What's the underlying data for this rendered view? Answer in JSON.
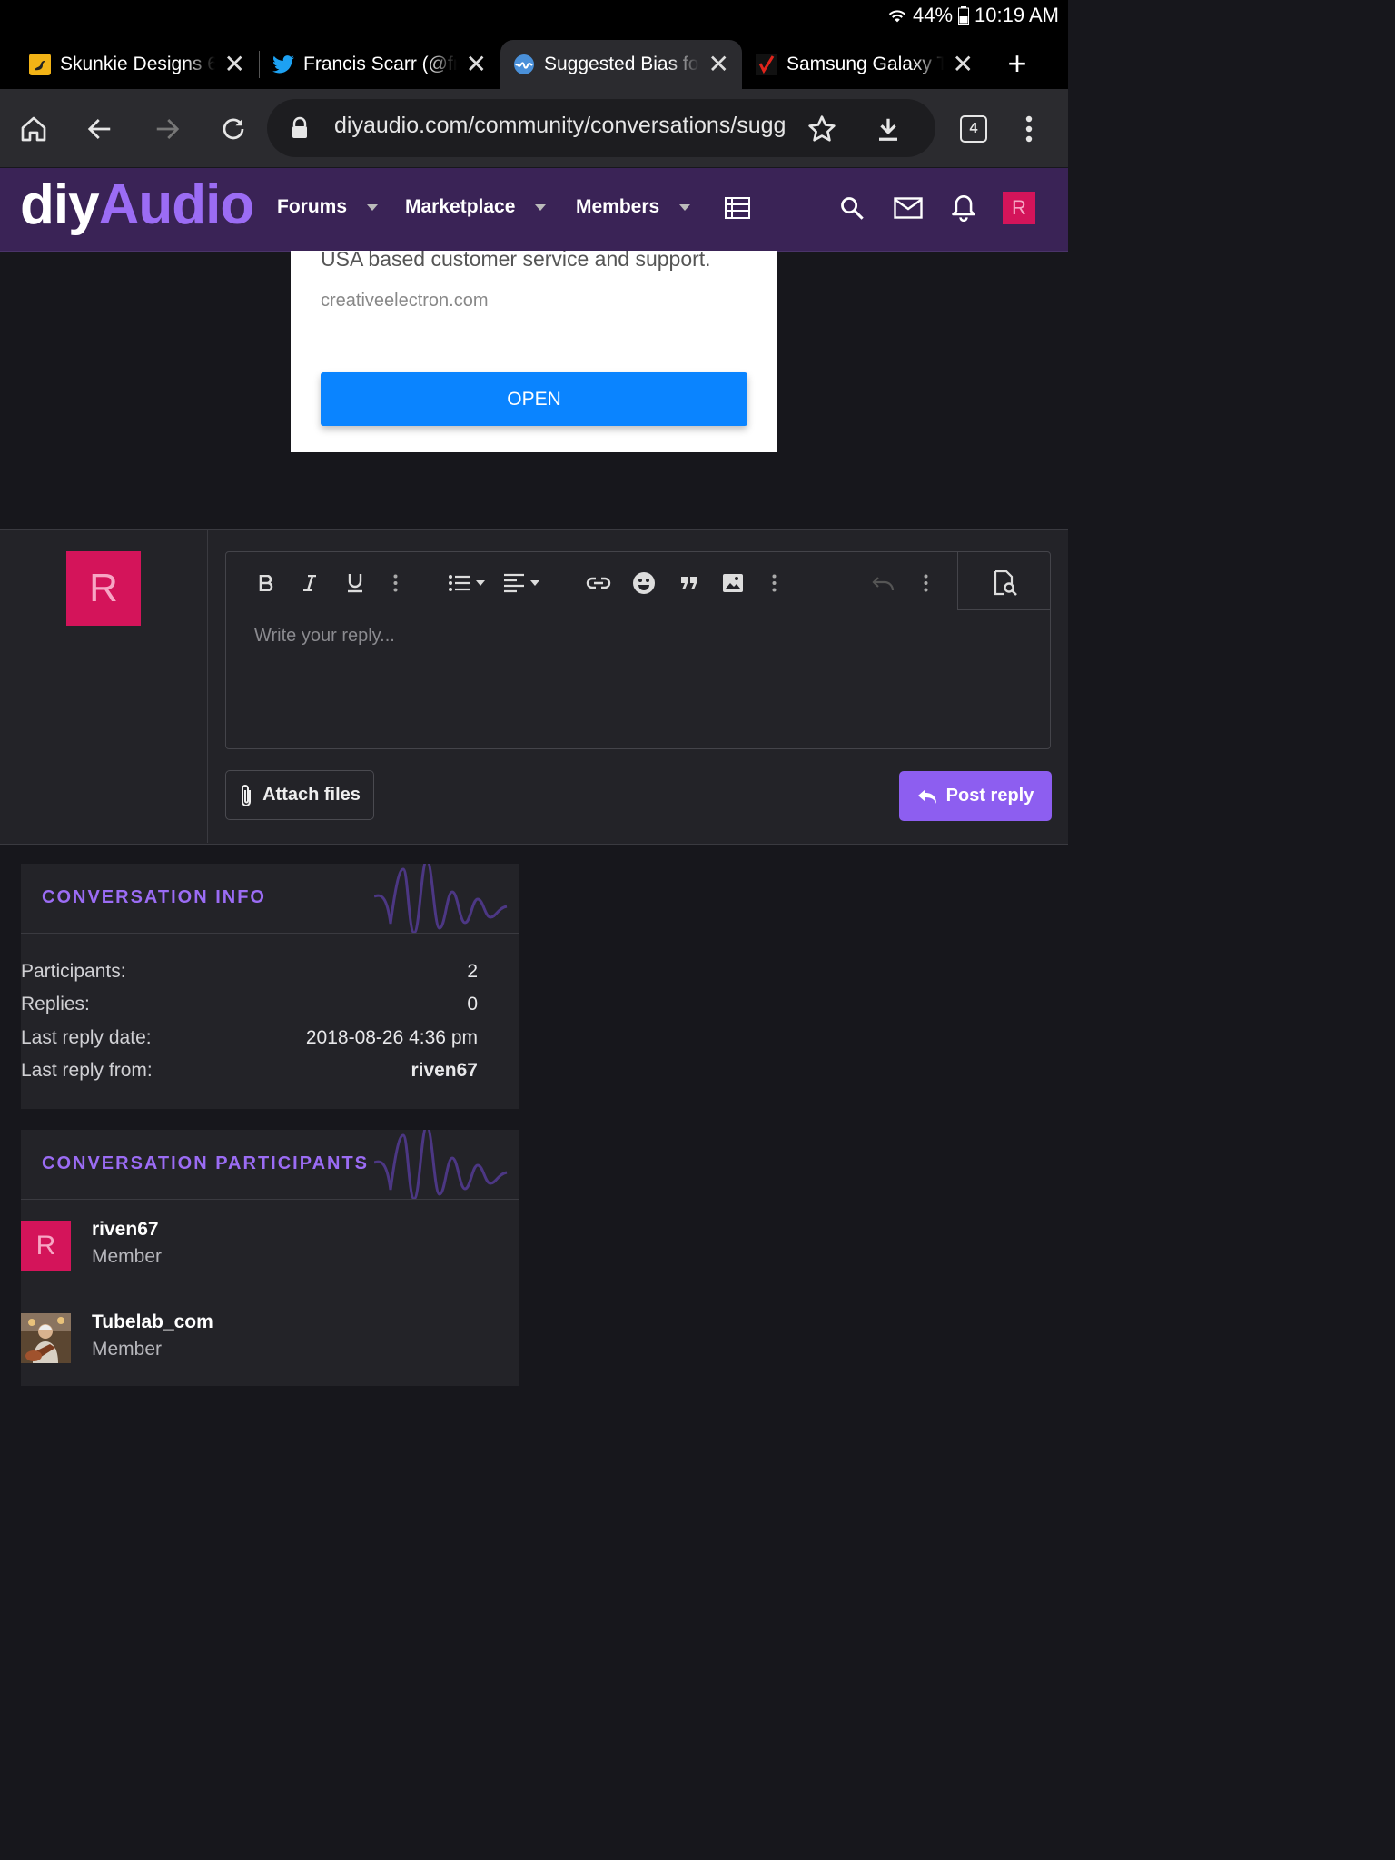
{
  "status_bar": {
    "battery": "44%",
    "time": "10:19 AM"
  },
  "tabs": [
    {
      "title": "Skunkie Designs 6",
      "close": "✕"
    },
    {
      "title": "Francis Scarr (@fr",
      "close": "✕"
    },
    {
      "title": "Suggested Bias fo",
      "close": "✕"
    },
    {
      "title": "Samsung Galaxy T",
      "close": "✕"
    }
  ],
  "new_tab": "+",
  "toolbar": {
    "url": "diyaudio.com/community/conversations/sugg",
    "tab_count": "4"
  },
  "site": {
    "logo_a": "diy",
    "logo_b": "Audio",
    "nav": [
      "Forums",
      "Marketplace",
      "Members"
    ],
    "user_initial": "R"
  },
  "ad": {
    "description": "USA based customer service and support.",
    "domain": "creativeelectron.com",
    "button": "OPEN"
  },
  "reply": {
    "avatar_initial": "R",
    "placeholder": "Write your reply...",
    "attach_label": "Attach files",
    "post_label": "Post reply"
  },
  "conversation_info": {
    "title": "CONVERSATION INFO",
    "rows": [
      {
        "label": "Participants:",
        "value": "2"
      },
      {
        "label": "Replies:",
        "value": "0"
      },
      {
        "label": "Last reply date:",
        "value": "2018-08-26 4:36 pm"
      },
      {
        "label": "Last reply from:",
        "value": "riven67"
      }
    ]
  },
  "participants_block": {
    "title": "CONVERSATION PARTICIPANTS",
    "items": [
      {
        "name": "riven67",
        "role": "Member",
        "initial": "R"
      },
      {
        "name": "Tubelab_com",
        "role": "Member"
      }
    ]
  },
  "colors": {
    "accent": "#9b6cf4",
    "nav_bg": "#3a2356",
    "avatar": "#d4145a",
    "ad_button": "#0a84ff"
  }
}
